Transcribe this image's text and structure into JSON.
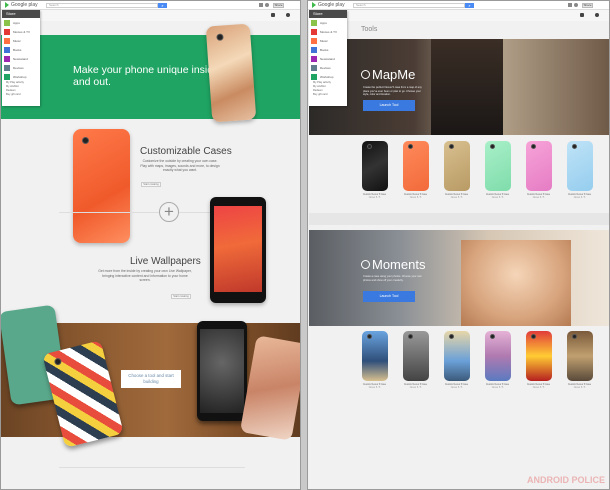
{
  "store": {
    "brand": "Google play",
    "search_placeholder": "Search",
    "share_label": "Share"
  },
  "menu": {
    "header": "Store",
    "items": [
      {
        "label": "Apps",
        "color": "#8bc34a"
      },
      {
        "label": "Movies & TV",
        "color": "#e53935"
      },
      {
        "label": "Music",
        "color": "#ff7043"
      },
      {
        "label": "Books",
        "color": "#3f74d6"
      },
      {
        "label": "Newsstand",
        "color": "#9c27b0"
      },
      {
        "label": "Devices",
        "color": "#607d8b"
      },
      {
        "label": "Workshop",
        "color": "#1fa463"
      }
    ],
    "links": [
      "My Play activity",
      "My wishlist",
      "Redeem",
      "Buy gift card"
    ]
  },
  "left": {
    "hero_title": "Make your phone unique inside and out.",
    "cases": {
      "title": "Customizable Cases",
      "body": "Customize the outside by creating your own case. Play with maps, images, sounds and more, to design exactly what you want.",
      "button": "Start creating"
    },
    "wallpapers": {
      "title": "Live Wallpapers",
      "body": "Get more from the inside by creating your own Live Wallpaper, bringing interactive content and information to your home screen.",
      "button": "Start creating"
    },
    "cta": "Choose a tool and start building"
  },
  "right": {
    "tools_title": "Tools",
    "mapme": {
      "title": "MapMe",
      "desc": "Create the perfect Nexus 5 case from a map of any place you've ever been or plan to go. Choose your style, color and location.",
      "button": "Launch Tool"
    },
    "moments": {
      "title": "Moments",
      "desc": "Create a case using your photos. Choose your own photos and show off your creativity.",
      "button": "Launch Tool"
    },
    "map_cases": [
      {
        "title": "Custom Nexus 5 Case",
        "sub": "Nexus 5 / 5"
      },
      {
        "title": "Custom Nexus 5 Case",
        "sub": "Nexus 5 / 5"
      },
      {
        "title": "Custom Nexus 5 Case",
        "sub": "Nexus 5 / 5"
      },
      {
        "title": "Custom Nexus 5 Case",
        "sub": "Nexus 5 / 5"
      },
      {
        "title": "Custom Nexus 5 Case",
        "sub": "Nexus 5 / 5"
      },
      {
        "title": "Custom Nexus 5 Case",
        "sub": "Nexus 5 / 5"
      }
    ],
    "moment_cases": [
      {
        "title": "Custom Nexus 5 Case",
        "sub": "Nexus 5 / 5"
      },
      {
        "title": "Custom Nexus 5 Case",
        "sub": "Nexus 5 / 5"
      },
      {
        "title": "Custom Nexus 5 Case",
        "sub": "Nexus 5 / 5"
      },
      {
        "title": "Custom Nexus 5 Case",
        "sub": "Nexus 5 / 5"
      },
      {
        "title": "Custom Nexus 5 Case",
        "sub": "Nexus 5 / 5"
      },
      {
        "title": "Custom Nexus 5 Case",
        "sub": "Nexus 5 / 5"
      }
    ]
  },
  "watermark": "ANDROID POLICE"
}
